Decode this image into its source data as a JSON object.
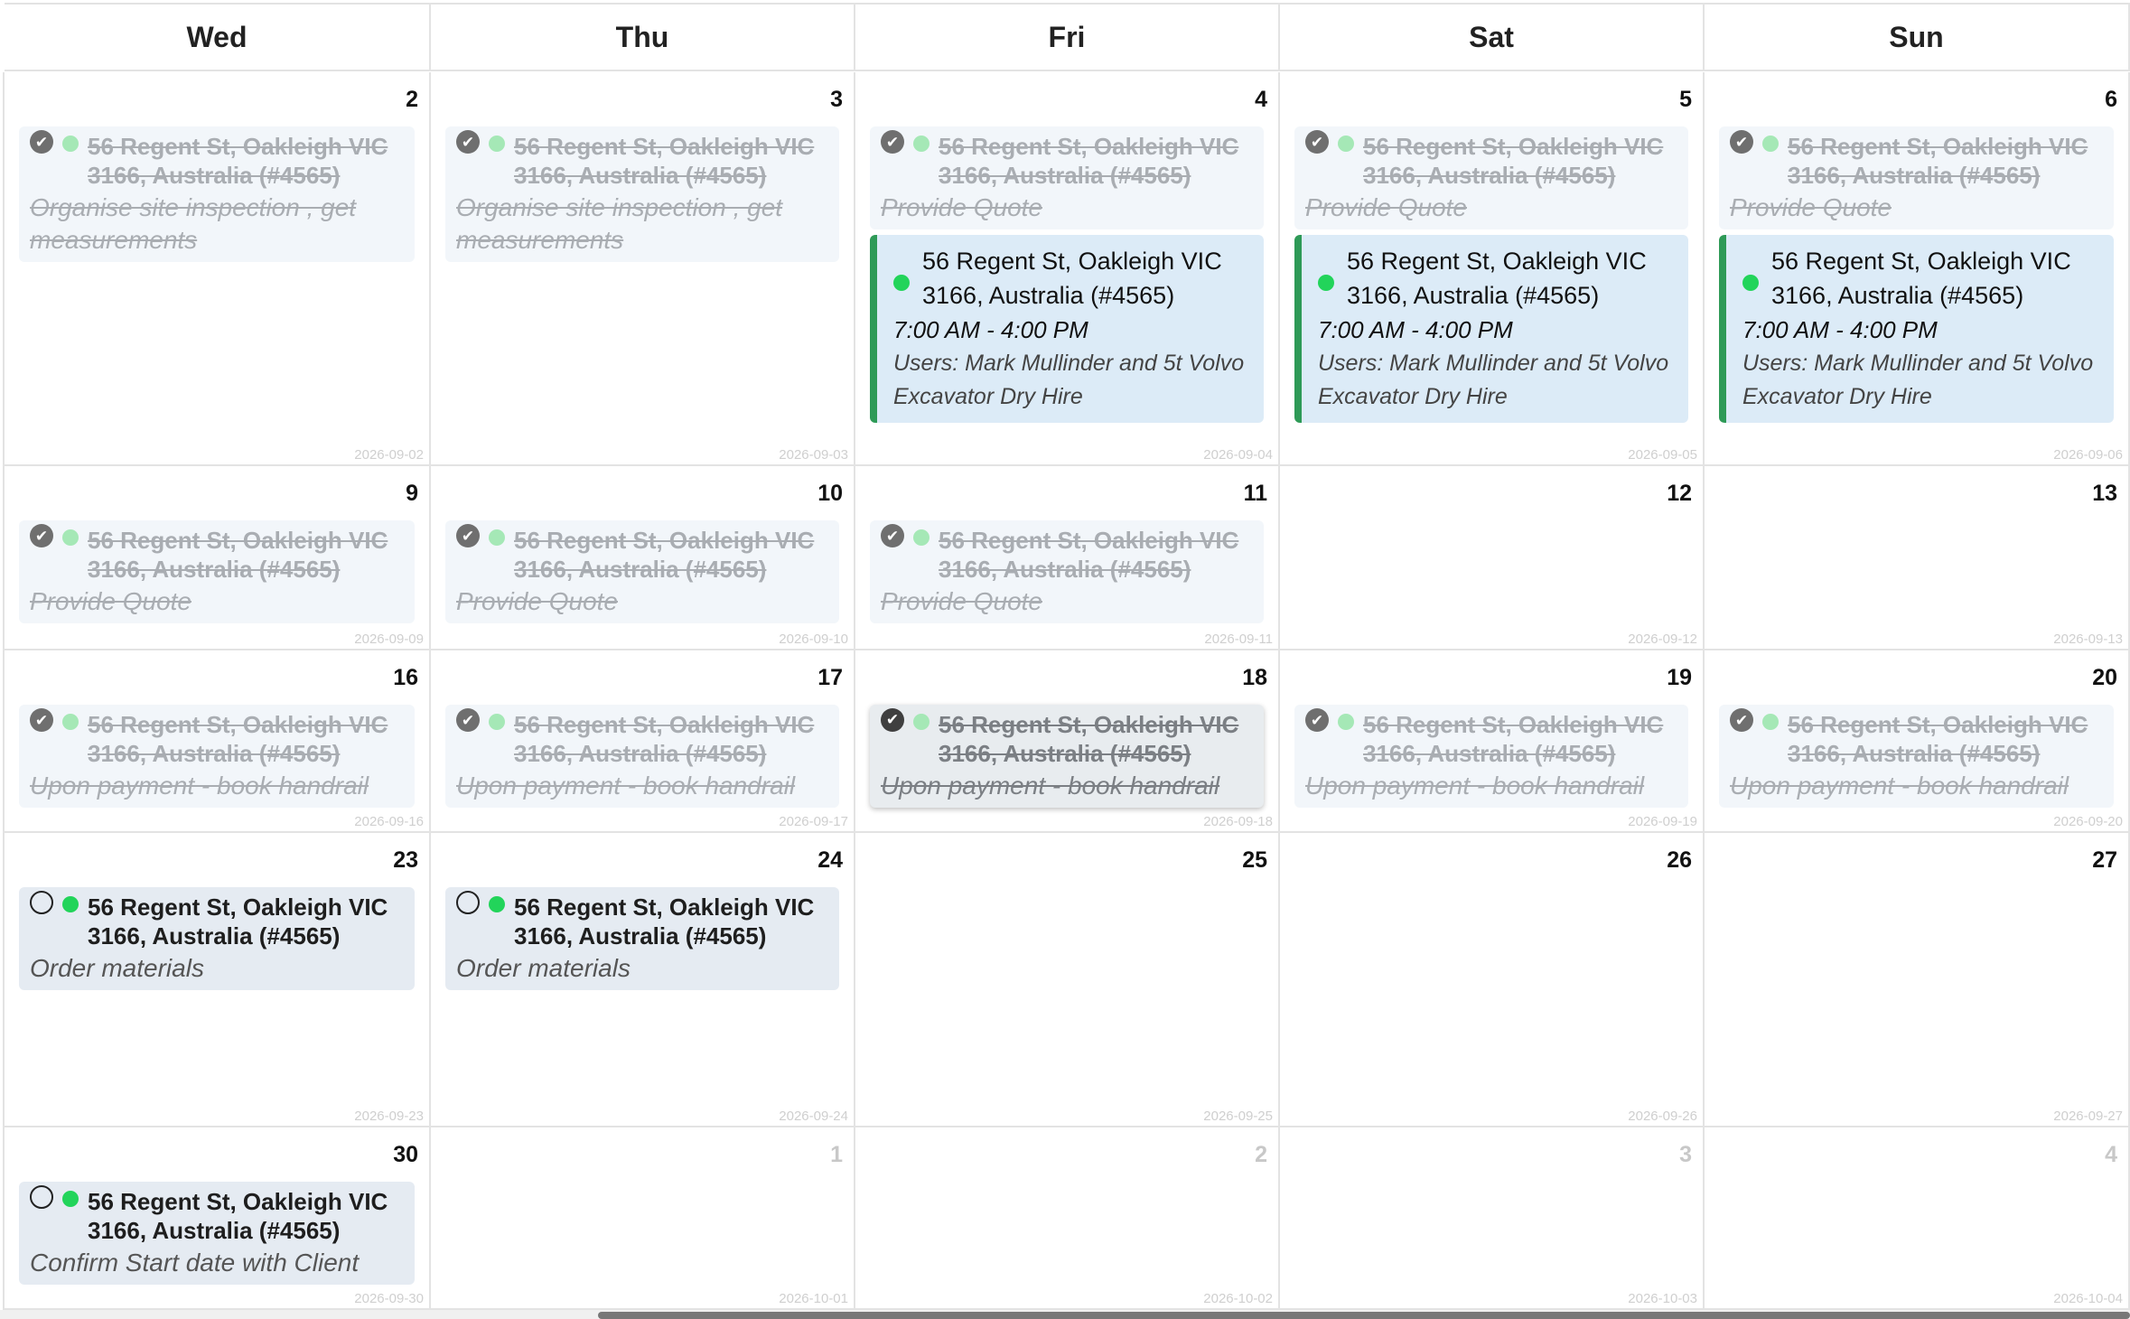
{
  "weekdays": [
    "Wed",
    "Thu",
    "Fri",
    "Sat",
    "Sun"
  ],
  "weeks": [
    {
      "days": [
        {
          "day": "2",
          "iso": "2026-09-02",
          "other": false,
          "events": [
            {
              "status": "done",
              "address": "56 Regent St, Oakleigh VIC 3166, Australia (#4565)",
              "task": "Organise site inspection , get measurements"
            }
          ]
        },
        {
          "day": "3",
          "iso": "2026-09-03",
          "other": false,
          "events": [
            {
              "status": "done",
              "address": "56 Regent St, Oakleigh VIC 3166, Australia (#4565)",
              "task": "Organise site inspection , get measurements"
            }
          ]
        },
        {
          "day": "4",
          "iso": "2026-09-04",
          "other": false,
          "events": [
            {
              "status": "done",
              "address": "56 Regent St, Oakleigh VIC 3166, Australia (#4565)",
              "task": "Provide Quote"
            }
          ],
          "booking": {
            "address": "56 Regent St, Oakleigh VIC 3166, Australia (#4565)",
            "time": "7:00 AM - 4:00 PM",
            "users": "Users: Mark Mullinder and 5t Volvo Excavator Dry Hire"
          }
        },
        {
          "day": "5",
          "iso": "2026-09-05",
          "other": false,
          "events": [
            {
              "status": "done",
              "address": "56 Regent St, Oakleigh VIC 3166, Australia (#4565)",
              "task": "Provide Quote"
            }
          ],
          "booking": {
            "address": "56 Regent St, Oakleigh VIC 3166, Australia (#4565)",
            "time": "7:00 AM - 4:00 PM",
            "users": "Users: Mark Mullinder and 5t Volvo Excavator Dry Hire"
          }
        },
        {
          "day": "6",
          "iso": "2026-09-06",
          "other": false,
          "events": [
            {
              "status": "done",
              "address": "56 Regent St, Oakleigh VIC 3166, Australia (#4565)",
              "task": "Provide Quote"
            }
          ],
          "booking": {
            "address": "56 Regent St, Oakleigh VIC 3166, Australia (#4565)",
            "time": "7:00 AM - 4:00 PM",
            "users": "Users: Mark Mullinder and 5t Volvo Excavator Dry Hire"
          }
        }
      ]
    },
    {
      "days": [
        {
          "day": "9",
          "iso": "2026-09-09",
          "other": false,
          "events": [
            {
              "status": "done",
              "address": "56 Regent St, Oakleigh VIC 3166, Australia (#4565)",
              "task": "Provide Quote"
            }
          ]
        },
        {
          "day": "10",
          "iso": "2026-09-10",
          "other": false,
          "events": [
            {
              "status": "done",
              "address": "56 Regent St, Oakleigh VIC 3166, Australia (#4565)",
              "task": "Provide Quote"
            }
          ]
        },
        {
          "day": "11",
          "iso": "2026-09-11",
          "other": false,
          "events": [
            {
              "status": "done",
              "address": "56 Regent St, Oakleigh VIC 3166, Australia (#4565)",
              "task": "Provide Quote"
            }
          ]
        },
        {
          "day": "12",
          "iso": "2026-09-12",
          "other": false,
          "events": []
        },
        {
          "day": "13",
          "iso": "2026-09-13",
          "other": false,
          "events": []
        }
      ]
    },
    {
      "days": [
        {
          "day": "16",
          "iso": "2026-09-16",
          "other": false,
          "events": [
            {
              "status": "done",
              "address": "56 Regent St, Oakleigh VIC 3166, Australia (#4565)",
              "task": "Upon payment - book handrail"
            }
          ]
        },
        {
          "day": "17",
          "iso": "2026-09-17",
          "other": false,
          "events": [
            {
              "status": "done",
              "address": "56 Regent St, Oakleigh VIC 3166, Australia (#4565)",
              "task": "Upon payment - book handrail"
            }
          ]
        },
        {
          "day": "18",
          "iso": "2026-09-18",
          "other": false,
          "events": [
            {
              "status": "hover",
              "address": "56 Regent St, Oakleigh VIC 3166, Australia (#4565)",
              "task": "Upon payment - book handrail"
            }
          ]
        },
        {
          "day": "19",
          "iso": "2026-09-19",
          "other": false,
          "events": [
            {
              "status": "done",
              "address": "56 Regent St, Oakleigh VIC 3166, Australia (#4565)",
              "task": "Upon payment - book handrail"
            }
          ]
        },
        {
          "day": "20",
          "iso": "2026-09-20",
          "other": false,
          "events": [
            {
              "status": "done",
              "address": "56 Regent St, Oakleigh VIC 3166, Australia (#4565)",
              "task": "Upon payment - book handrail"
            }
          ]
        }
      ]
    },
    {
      "days": [
        {
          "day": "23",
          "iso": "2026-09-23",
          "other": false,
          "events": [
            {
              "status": "todo",
              "address": "56 Regent St, Oakleigh VIC 3166, Australia (#4565)",
              "task": "Order materials"
            }
          ]
        },
        {
          "day": "24",
          "iso": "2026-09-24",
          "other": false,
          "events": [
            {
              "status": "todo",
              "address": "56 Regent St, Oakleigh VIC 3166, Australia (#4565)",
              "task": "Order materials"
            }
          ]
        },
        {
          "day": "25",
          "iso": "2026-09-25",
          "other": false,
          "events": []
        },
        {
          "day": "26",
          "iso": "2026-09-26",
          "other": false,
          "events": []
        },
        {
          "day": "27",
          "iso": "2026-09-27",
          "other": false,
          "events": []
        }
      ]
    },
    {
      "days": [
        {
          "day": "30",
          "iso": "2026-09-30",
          "other": false,
          "events": [
            {
              "status": "todo",
              "address": "56 Regent St, Oakleigh VIC 3166, Australia (#4565)",
              "task": "Confirm Start date with Client"
            }
          ]
        },
        {
          "day": "1",
          "iso": "2026-10-01",
          "other": true,
          "events": []
        },
        {
          "day": "2",
          "iso": "2026-10-02",
          "other": true,
          "events": []
        },
        {
          "day": "3",
          "iso": "2026-10-03",
          "other": true,
          "events": []
        },
        {
          "day": "4",
          "iso": "2026-10-04",
          "other": true,
          "events": []
        }
      ]
    }
  ],
  "colors": {
    "done_bg": "#f2f6fa",
    "todo_bg": "#e5ebf2",
    "booking_bg": "#dcebf7",
    "booking_bar": "#2e9a57",
    "dot_bright": "#22d45a",
    "dot_faint": "#a5e8b6"
  }
}
